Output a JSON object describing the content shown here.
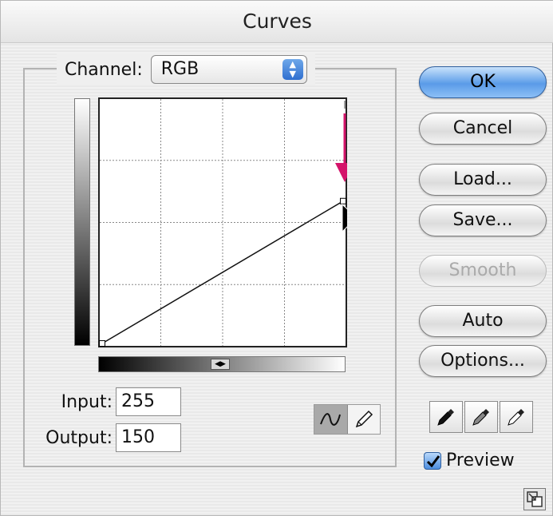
{
  "window": {
    "title": "Curves"
  },
  "channel": {
    "label": "Channel:",
    "value": "RGB"
  },
  "fields": {
    "input_label": "Input:",
    "input_value": "255",
    "output_label": "Output:",
    "output_value": "150"
  },
  "buttons": {
    "ok": "OK",
    "cancel": "Cancel",
    "load": "Load...",
    "save": "Save...",
    "smooth": "Smooth",
    "auto": "Auto",
    "options": "Options..."
  },
  "preview": {
    "label": "Preview",
    "checked": true
  },
  "curve": {
    "points": [
      [
        0,
        0
      ],
      [
        255,
        150
      ]
    ],
    "range": [
      0,
      255
    ]
  },
  "colors": {
    "accent": "#3a7fdc",
    "annotation_arrow": "#d4146a"
  },
  "icons": {
    "curve_tool": "curve-tool-icon",
    "pencil_tool": "pencil-icon",
    "black_eyedropper": "eyedropper-black-icon",
    "gray_eyedropper": "eyedropper-gray-icon",
    "white_eyedropper": "eyedropper-white-icon",
    "resize": "resize-grip-icon"
  }
}
